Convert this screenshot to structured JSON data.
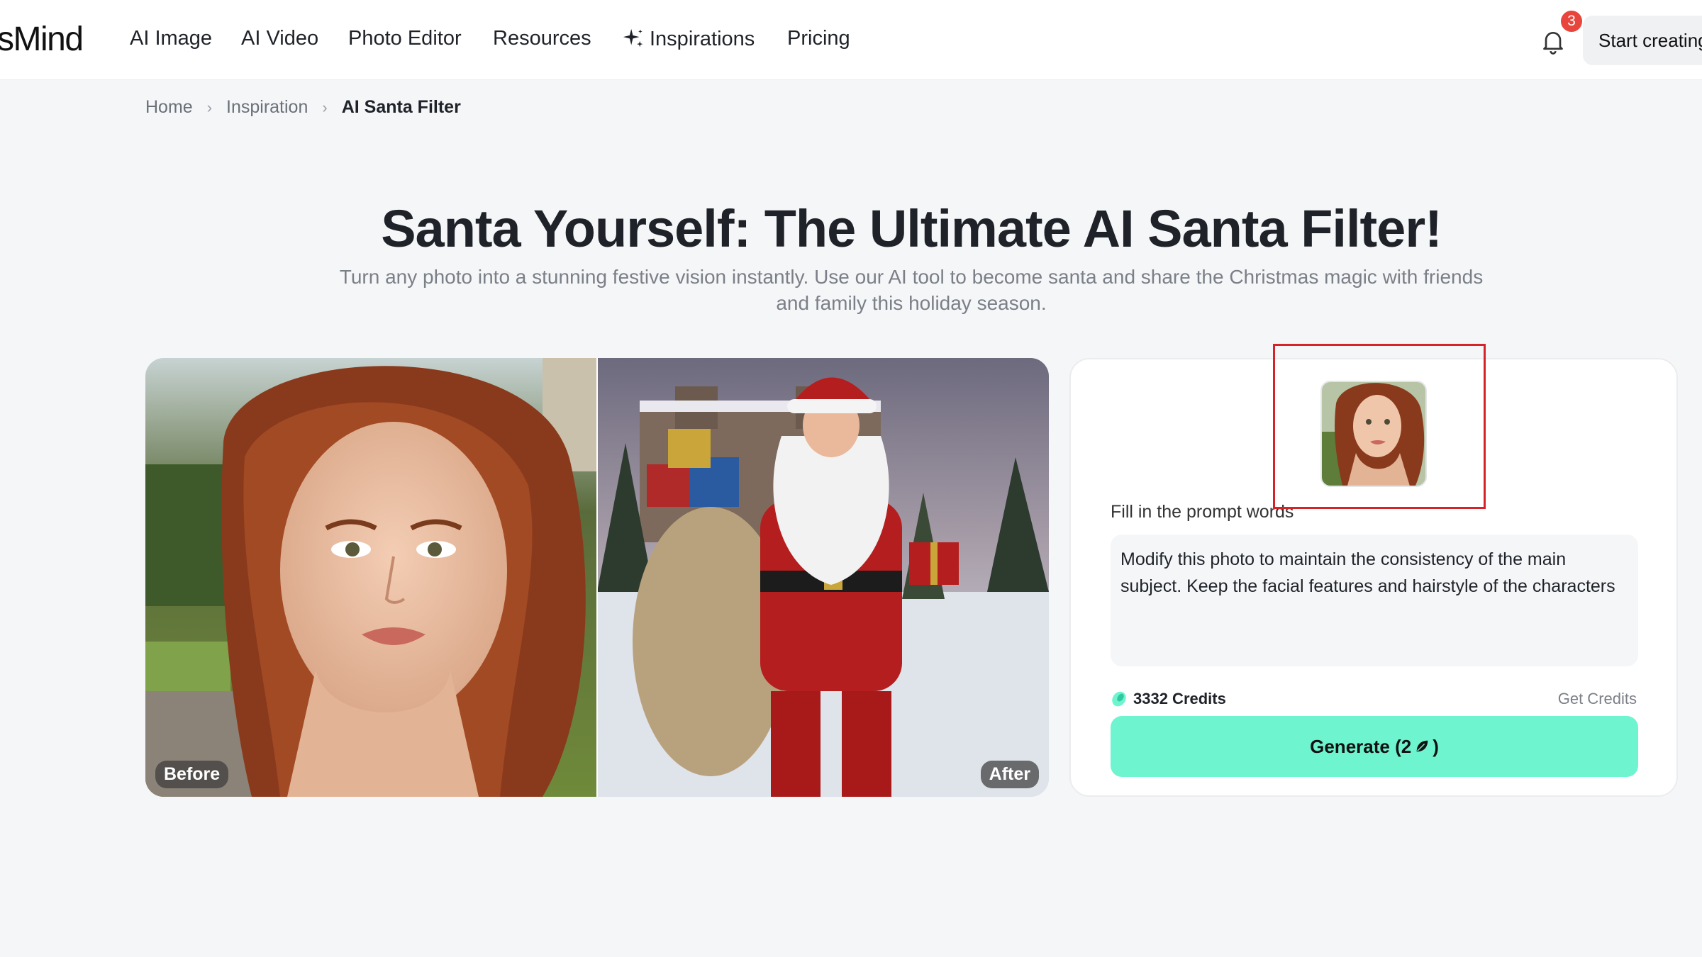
{
  "nav": {
    "logo": "sMind",
    "items": [
      {
        "label": "AI Image"
      },
      {
        "label": "AI Video"
      },
      {
        "label": "Photo Editor"
      },
      {
        "label": "Resources"
      },
      {
        "label": "Inspirations",
        "icon": "sparkle-icon"
      },
      {
        "label": "Pricing"
      }
    ],
    "notification_count": "3",
    "start_button": "Start creating"
  },
  "breadcrumb": {
    "home": "Home",
    "inspiration": "Inspiration",
    "current": "AI Santa Filter"
  },
  "hero": {
    "title": "Santa Yourself: The Ultimate AI Santa Filter!",
    "subtitle_line1": "Turn any photo into a stunning festive vision instantly. Use our AI tool to become santa and share the Christmas magic with friends",
    "subtitle_line2": "and family this holiday season."
  },
  "compare": {
    "before_label": "Before",
    "after_label": "After"
  },
  "panel": {
    "prompt_label": "Fill in the prompt words",
    "prompt_value": "Modify this photo to maintain the consistency of the main subject. Keep the facial features and hairstyle of the characters",
    "credits_label": "3332 Credits",
    "get_credits": "Get Credits",
    "generate_label": "Generate (2",
    "generate_suffix": ")"
  },
  "colors": {
    "accent": "#6ef5cf",
    "badge": "#e8453c",
    "highlight": "#d6232a"
  }
}
